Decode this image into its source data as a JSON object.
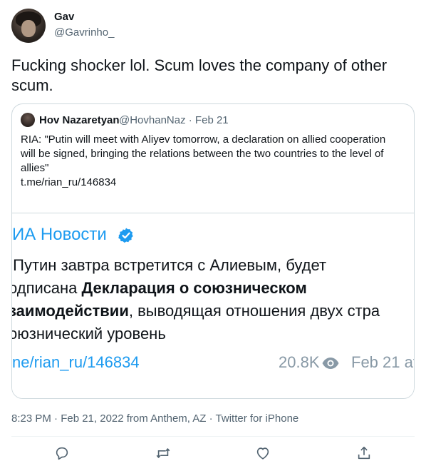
{
  "author": {
    "name": "Gav",
    "handle": "@Gavrinho_"
  },
  "tweet": {
    "text": "Fucking shocker lol. Scum loves the company of other scum."
  },
  "quote": {
    "name": "Hov Nazaretyan",
    "meta": "@HovhanNaz · Feb 21",
    "text_line1": "RIA: \"Putin will meet with Aliyev tomorrow, a declaration on allied cooperation",
    "text_line2": "will be signed, bringing the relations between the two countries to the level of",
    "text_line3": "allies\"",
    "link": "t.me/rian_ru/146834",
    "embed": {
      "title": "ИА Новости",
      "line1": "Путин завтра встретится с Алиевым, будет",
      "line2_pre": "одписана ",
      "line2_bold": "Декларация о союзническом",
      "line3_bold": "заимодействии",
      "line3_post": ", выводящая отношения двух стра",
      "line4": "оюзнический уровень",
      "link": "ne/rian_ru/146834",
      "views": "20.8K",
      "date": "Feb 21 at"
    }
  },
  "timestamp": "8:23 PM · Feb 21, 2022 from Anthem, AZ · Twitter for iPhone",
  "colors": {
    "link": "#1d9bf0",
    "secondary_text": "#536471",
    "border": "#cfd9de"
  },
  "icons": [
    "reply-icon",
    "retweet-icon",
    "like-icon",
    "share-icon",
    "verified-badge-icon",
    "eye-icon"
  ]
}
